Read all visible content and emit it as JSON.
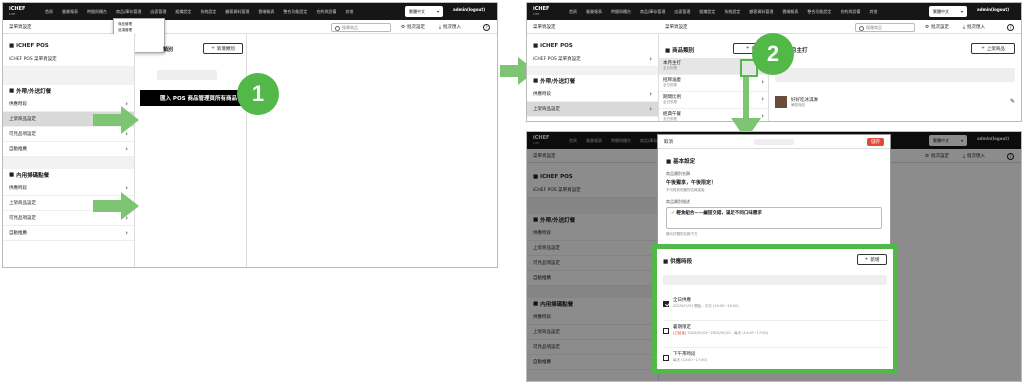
{
  "app": {
    "brand": "iCHEF",
    "brand_sub": "LITE",
    "nav": [
      "首頁",
      "營業報表",
      "時間與櫃台",
      "商品/庫存管理",
      "店面管理",
      "組織設定",
      "系統設定",
      "顧客資料管理",
      "雲端報表",
      "整合功能設定",
      "合約與設備",
      "其他"
    ],
    "lang": "繁體中文",
    "admin": "admin(logout)",
    "search_placeholder": "搜尋商品",
    "batch_settings": "批次設定",
    "batch_import": "批次匯入",
    "help": "?"
  },
  "left": {
    "page_title": "菜單頁設定",
    "dropdown": [
      "商品管理",
      "品項管理",
      "菜單頁設定",
      "庫存管理"
    ],
    "col2_header": "類別",
    "add_category": "新增類別",
    "import_btn": "匯入 POS 商品管理頁所有商品",
    "step": "1"
  },
  "sidebar": {
    "pos_title": "iCHEF POS",
    "pos_item": "iCHEF POS 菜單頁設定",
    "takeout_title": "外帶/外送訂餐",
    "takeout_items": [
      "供應時段",
      "上架商品設定",
      "可見品項設定",
      "自動推薦"
    ],
    "dinein_title": "內用掃碼點餐",
    "dinein_items": [
      "供應時段",
      "上架商品設定",
      "可見品項設定",
      "自動推薦"
    ]
  },
  "right_top": {
    "category_header": "商品類別",
    "add_short": "新",
    "categories": [
      {
        "name": "本月主打",
        "sub": "全日供應"
      },
      {
        "name": "招牌滷麼",
        "sub": "全日供應"
      },
      {
        "name": "期間比例",
        "sub": "全日供應"
      },
      {
        "name": "經典午餐",
        "sub": "全日供應"
      }
    ],
    "product_header": "月主打",
    "add_product": "上架商品",
    "product_name": "好好吃冰淇淋",
    "product_sub": "單點商品",
    "step": "2"
  },
  "modal": {
    "cancel": "取消",
    "save": "儲存",
    "basic_title": "基本設定",
    "name_label": "商品類別名稱",
    "name_value": "午後獨享，午後限定！",
    "name_hint": "不可與其他類別名稱重複",
    "desc_label": "商品類別描述",
    "desc_value": "輕食組合——鹹甜交錯，滿足不同口味需求",
    "desc_hint": "顯示於類別名稱下方",
    "period_title": "供應時段",
    "add": "新增",
    "periods": [
      {
        "name": "全日供應",
        "date": "2025/07/01 開始",
        "detail": "- 平日 (10:00~14:00)",
        "checked": true,
        "tag": ""
      },
      {
        "name": "暑期限定",
        "date": "2025/01/02~2025/01/10",
        "detail": "- 每天 (14:00~17:00)",
        "checked": false,
        "tag": "已結束"
      },
      {
        "name": "下午茶時段",
        "date": "",
        "detail": "每天 (14:00~17:00)",
        "checked": false,
        "tag": ""
      }
    ]
  },
  "colors": {
    "green": "#52b848",
    "arrow": "#7dc573",
    "black": "#000000",
    "save": "#e04c3c"
  }
}
